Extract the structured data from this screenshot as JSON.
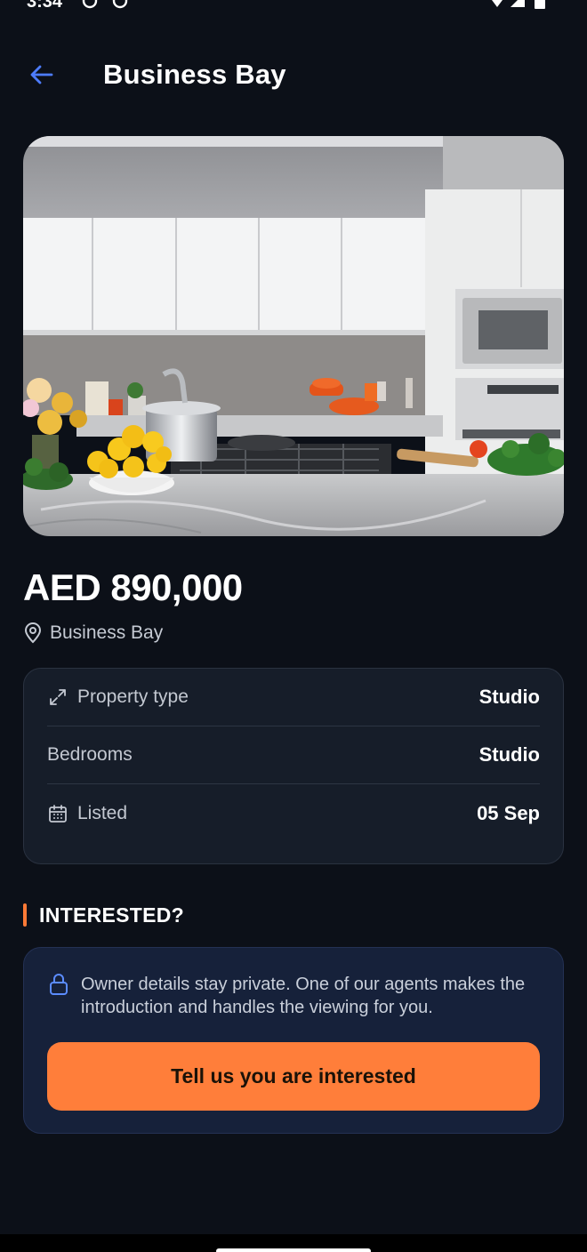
{
  "status_bar": {
    "time": "3:34"
  },
  "header": {
    "title": "Business Bay",
    "back_icon": "arrow-left-icon"
  },
  "listing": {
    "image_alt": "Modern white kitchen",
    "price": "AED 890,000",
    "location": "Business Bay",
    "location_icon": "map-pin-icon"
  },
  "details": [
    {
      "label": "Property type",
      "value": "Studio",
      "icon": "expand-arrows-icon"
    },
    {
      "label": "Bedrooms",
      "value": "Studio",
      "icon": ""
    },
    {
      "label": "Listed",
      "value": "05 Sep",
      "icon": "calendar-icon"
    }
  ],
  "interest": {
    "heading": "INTERESTED?",
    "privacy_text": "Owner details stay private. One of our agents makes the introduction and handles the viewing for you.",
    "privacy_icon": "lock-icon",
    "cta_label": "Tell us you are interested"
  },
  "colors": {
    "background": "#0c1018",
    "accent": "#ff7e3a",
    "back_arrow": "#4d7cff",
    "card": "#161d29",
    "interest_card": "#16213a"
  }
}
